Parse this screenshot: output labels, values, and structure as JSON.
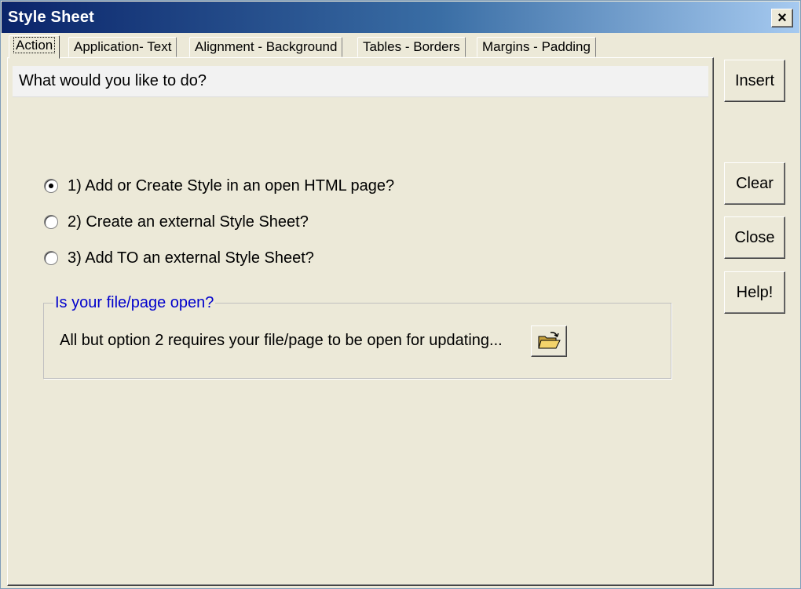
{
  "window": {
    "title": "Style Sheet",
    "close_label": "×"
  },
  "tabs": [
    {
      "label": "Action",
      "active": true
    },
    {
      "label": "Application- Text",
      "active": false
    },
    {
      "label": "Alignment - Background",
      "active": false
    },
    {
      "label": "Tables - Borders",
      "active": false
    },
    {
      "label": "Margins - Padding",
      "active": false
    }
  ],
  "action_tab": {
    "question": "What would you like to do?",
    "options": [
      {
        "label": "1) Add or Create Style in an open HTML page?",
        "checked": true
      },
      {
        "label": "2) Create an external Style Sheet?",
        "checked": false
      },
      {
        "label": "3) Add TO an external Style Sheet?",
        "checked": false
      }
    ],
    "group": {
      "legend": "Is your file/page open?",
      "text": "All but option 2 requires your file/page to be open for updating...",
      "button_icon": "open-folder-icon"
    }
  },
  "buttons": {
    "insert": "Insert",
    "clear": "Clear",
    "close": "Close",
    "help": "Help!"
  },
  "colors": {
    "title_gradient_start": "#0a246a",
    "title_gradient_end": "#a6caf0",
    "face": "#ece9d8",
    "legend": "#0000cc"
  }
}
